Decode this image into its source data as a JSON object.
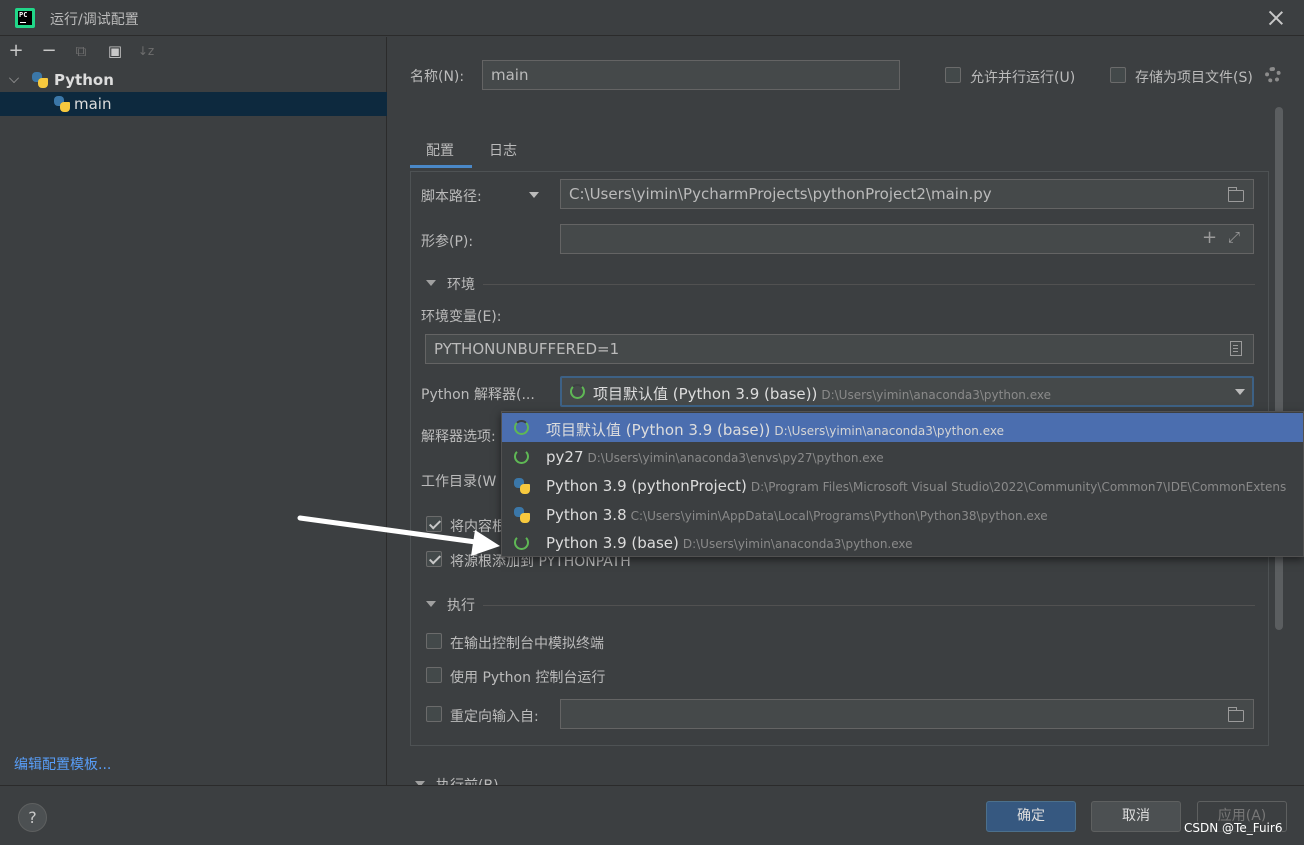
{
  "window": {
    "title": "运行/调试配置"
  },
  "left_toolbar": {
    "add": "+",
    "remove": "−",
    "copy": "⧉",
    "new_folder": "▣",
    "sort": "↓z"
  },
  "tree": {
    "group_label": "Python",
    "item_label": "main"
  },
  "edit_templates_link": "编辑配置模板...",
  "header": {
    "name_label": "名称(N):",
    "name_value": "main",
    "allow_parallel_label": "允许并行运行(U)",
    "store_as_project_file_label": "存储为项目文件(S)"
  },
  "tabs": [
    {
      "label": "配置",
      "active": true
    },
    {
      "label": "日志",
      "active": false
    }
  ],
  "config": {
    "script_path_label": "脚本路径:",
    "script_path_value": "C:\\Users\\yimin\\PycharmProjects\\pythonProject2\\main.py",
    "params_label": "形参(P):",
    "params_value": "",
    "env_section": "环境",
    "env_vars_label": "环境变量(E):",
    "env_vars_value": "PYTHONUNBUFFERED=1",
    "interpreter_label": "Python 解释器(...",
    "interpreter_name": "项目默认值 (Python 3.9 (base))",
    "interpreter_path": "D:\\Users\\yimin\\anaconda3\\python.exe",
    "interp_options_label": "解释器选项:",
    "workdir_label": "工作目录(W",
    "add_content_roots_label": "将内容根",
    "add_source_roots_label": "将源根添加到 PYTHONPATH",
    "exec_section": "执行",
    "emulate_terminal_label": "在输出控制台中模拟终端",
    "run_with_console_label": "使用 Python 控制台运行",
    "redirect_input_label": "重定向输入自:",
    "redirect_input_value": "",
    "before_launch_section": "执行前(B)"
  },
  "interpreter_dropdown": [
    {
      "name": "项目默认值 (Python 3.9 (base))",
      "path": "D:\\Users\\yimin\\anaconda3\\python.exe",
      "icon": "conda-icon",
      "selected": true
    },
    {
      "name": "py27",
      "path": "D:\\Users\\yimin\\anaconda3\\envs\\py27\\python.exe",
      "icon": "conda-icon",
      "selected": false
    },
    {
      "name": "Python 3.9 (pythonProject)",
      "path": "D:\\Program Files\\Microsoft Visual Studio\\2022\\Community\\Common7\\IDE\\CommonExtens",
      "icon": "python-icon",
      "selected": false
    },
    {
      "name": "Python 3.8",
      "path": "C:\\Users\\yimin\\AppData\\Local\\Programs\\Python\\Python38\\python.exe",
      "icon": "python-icon",
      "selected": false
    },
    {
      "name": "Python 3.9 (base)",
      "path": "D:\\Users\\yimin\\anaconda3\\python.exe",
      "icon": "conda-icon",
      "selected": false
    }
  ],
  "footer": {
    "help": "?",
    "ok": "确定",
    "cancel": "取消",
    "apply": "应用(A)",
    "watermark": "CSDN @Te_Fuir6"
  },
  "colors": {
    "background": "#3c3f41",
    "selection": "#4b6eaf",
    "link": "#589df6",
    "primary_button": "#365880"
  }
}
